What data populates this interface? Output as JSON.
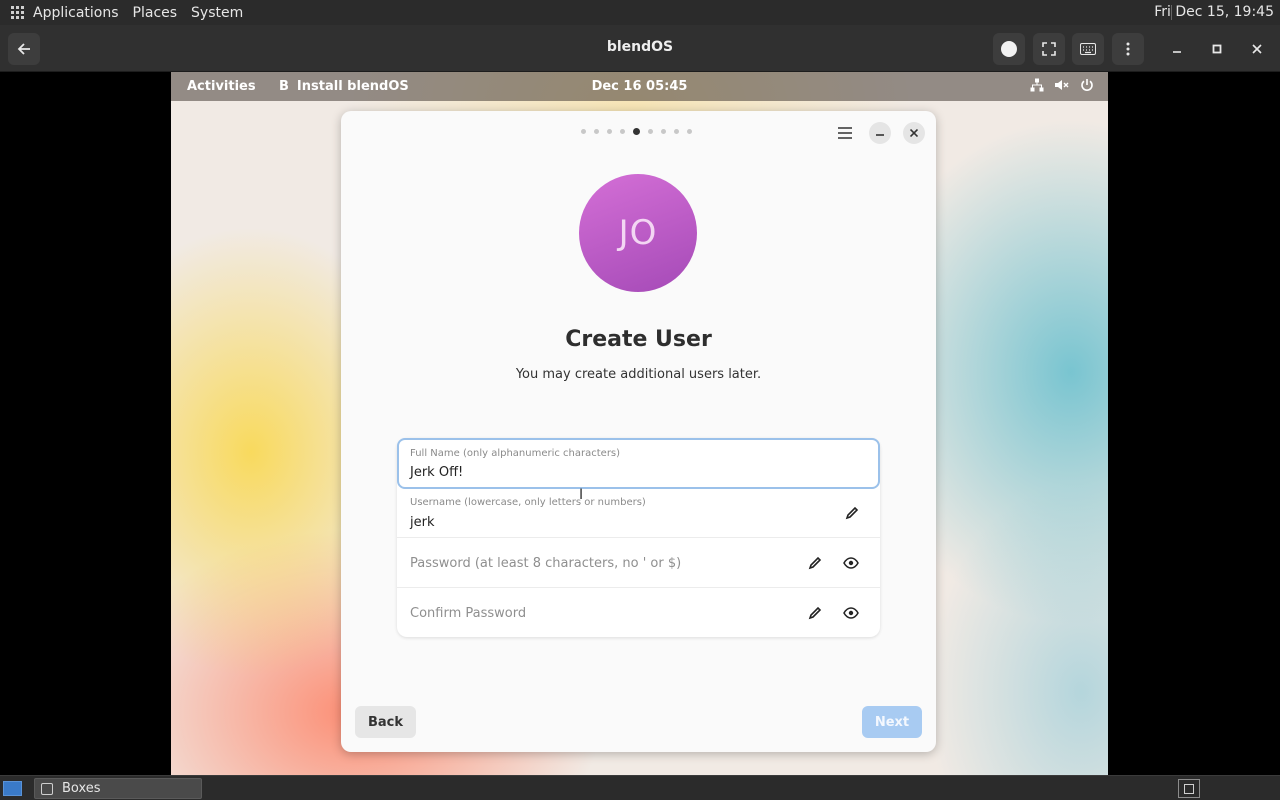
{
  "host_panel": {
    "menus": [
      "Applications",
      "Places",
      "System"
    ],
    "clock": "Fri Dec 15, 19:45"
  },
  "boxes": {
    "title": "blendOS"
  },
  "gnome_bar": {
    "activities": "Activities",
    "app_name": "Install blendOS",
    "app_initial": "B",
    "clock": "Dec 16  05:45"
  },
  "dialog": {
    "avatar_initials": "JO",
    "title": "Create User",
    "subtitle": "You may create additional users later.",
    "fields": {
      "full_name": {
        "label": "Full Name (only alphanumeric characters)",
        "value": "Jerk Off!"
      },
      "username": {
        "label": "Username (lowercase, only letters or numbers)",
        "value": "jerk"
      },
      "password": {
        "placeholder": "Password (at least 8 characters, no ' or $)"
      },
      "confirm": {
        "placeholder": "Confirm Password"
      }
    },
    "back_label": "Back",
    "next_label": "Next",
    "page_dots": 9,
    "active_dot": 5
  },
  "taskbar": {
    "task_label": "Boxes"
  },
  "colors": {
    "accent": "#9bc1ea",
    "next_button": "#a8cbf2",
    "avatar": "#c25fcb"
  }
}
